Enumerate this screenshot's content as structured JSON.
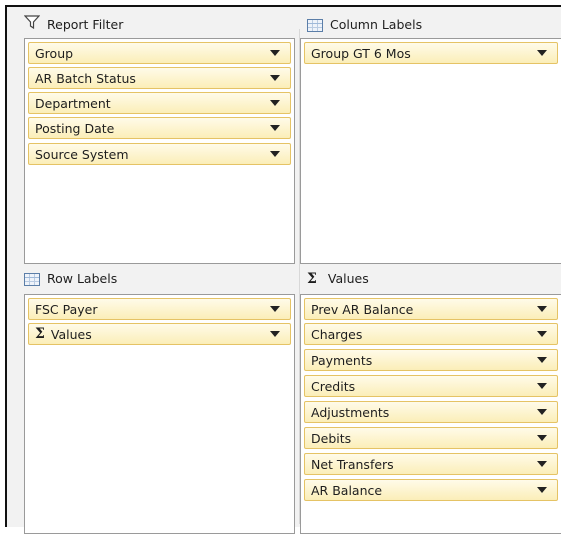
{
  "report_filter": {
    "title": "Report Filter",
    "icon": "filter-icon",
    "fields": [
      "Group",
      "AR Batch Status",
      "Department",
      "Posting Date",
      "Source System"
    ]
  },
  "column_labels": {
    "title": "Column Labels",
    "icon": "grid-icon",
    "fields": [
      "Group GT 6 Mos"
    ]
  },
  "row_labels": {
    "title": "Row Labels",
    "icon": "grid-icon",
    "fields": [
      "FSC Payer",
      "Values"
    ]
  },
  "values": {
    "title": "Values",
    "icon": "sigma-icon",
    "fields": [
      "Prev AR Balance",
      "Charges",
      "Payments",
      "Credits",
      "Adjustments",
      "Debits",
      "Net Transfers",
      "AR Balance"
    ]
  },
  "colors": {
    "field_fill": "#fbeeb8",
    "field_border": "#e5c365",
    "pane_border": "#9a9a9a"
  }
}
